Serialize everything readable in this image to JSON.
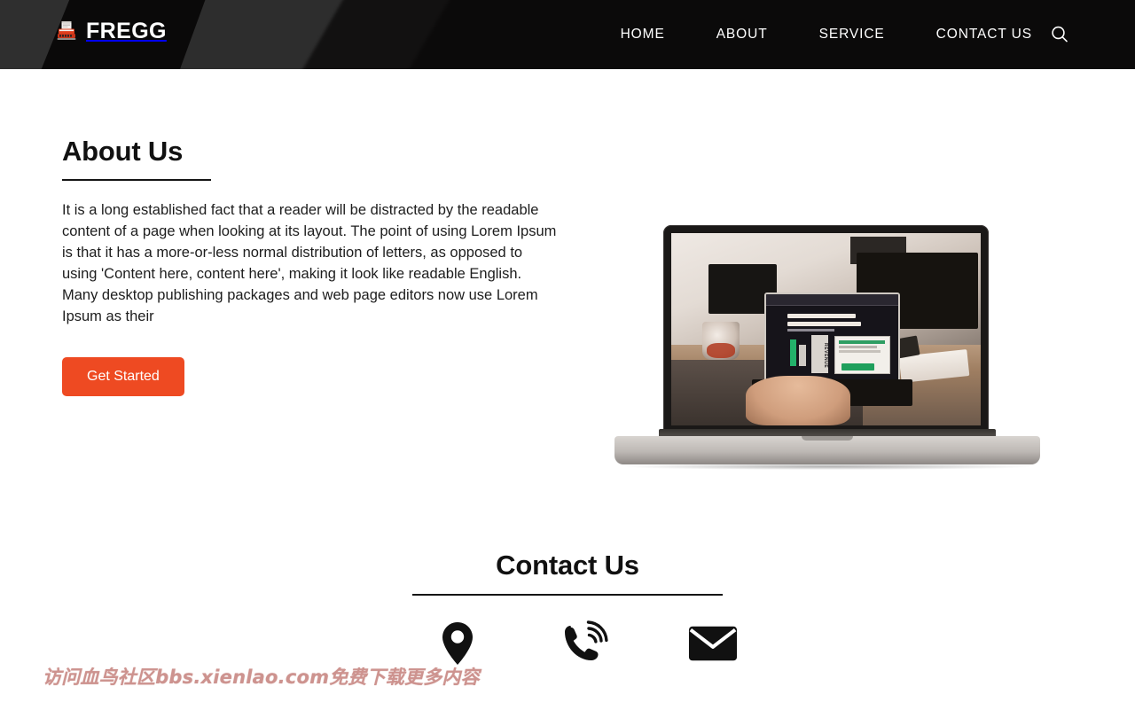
{
  "header": {
    "brand_name": "FREGG",
    "brand_icon": "typewriter-icon",
    "nav": [
      {
        "label": "HOME"
      },
      {
        "label": "ABOUT"
      },
      {
        "label": "SERVICE"
      },
      {
        "label": "CONTACT US"
      }
    ],
    "search_icon": "search-icon",
    "background_color": "#0b0a0a"
  },
  "about": {
    "heading": "About Us",
    "body": "It is a long established fact that a reader will be distracted by the readable content of a page when looking at its layout. The point of using Lorem Ipsum is that it has a more-or-less normal distribution of letters, as opposed to using 'Content here, content here', making it look like readable English. Many desktop publishing packages and web page editors now use Lorem Ipsum as their",
    "cta_label": "Get Started",
    "cta_color": "#ee4a22",
    "illustration": {
      "name": "laptop-mockup",
      "screen_label": "REVENUE"
    }
  },
  "contact": {
    "heading": "Contact Us",
    "icons": [
      {
        "name": "location-pin-icon"
      },
      {
        "name": "phone-icon"
      },
      {
        "name": "envelope-icon"
      }
    ]
  },
  "watermark": {
    "text": "访问血鸟社区bbs.xienlao.com免费下载更多内容",
    "color": "#c98a86"
  }
}
